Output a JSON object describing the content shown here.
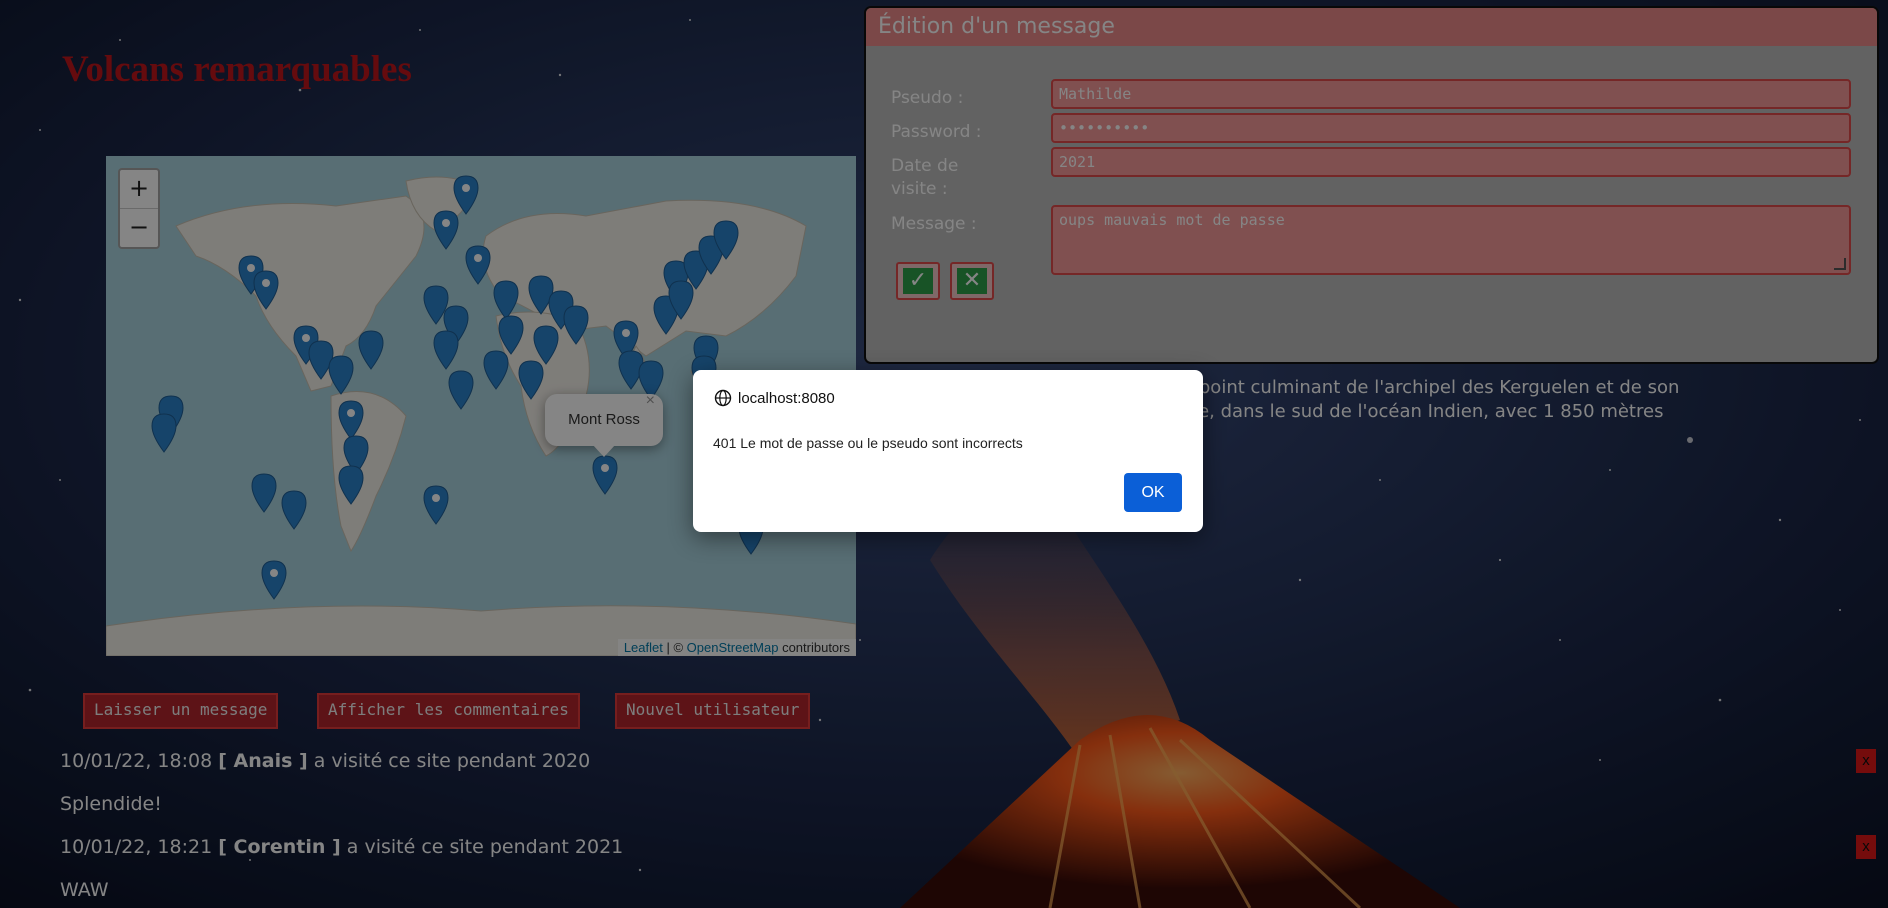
{
  "page": {
    "title": "Volcans remarquables",
    "description_lines": [
      "an, point culminant de l'archipel des Kerguelen et de son",
      "Terre, dans le sud de l'océan Indien, avec 1 850 mètres"
    ]
  },
  "map": {
    "zoom_in": "+",
    "zoom_out": "−",
    "popup_label": "Mont Ross",
    "popup_close": "×",
    "attribution": {
      "leaflet": "Leaflet",
      "separator": " | © ",
      "osm": "OpenStreetMap",
      "suffix": " contributors"
    }
  },
  "actions": {
    "leave_message": "Laisser un message",
    "show_comments": "Afficher les commentaires",
    "new_user": "Nouvel utilisateur"
  },
  "comments": [
    {
      "datetime": "10/01/22, 18:08",
      "user": "[ Anais ]",
      "visit": "a visité ce site pendant 2020",
      "text": "Splendide!",
      "delete": "x"
    },
    {
      "datetime": "10/01/22, 18:21",
      "user": "[ Corentin ]",
      "visit": "a visité ce site pendant 2021",
      "text": "WAW",
      "delete": "x"
    }
  ],
  "edit_panel": {
    "title": "Édition d'un message",
    "pseudo_label": "Pseudo :",
    "pseudo_value": "Mathilde",
    "password_label": "Password :",
    "password_value": "••••••••••",
    "date_label": "Date de visite :",
    "date_value": "2021",
    "message_label": "Message :",
    "message_value": "oups mauvais mot de passe",
    "confirm_icon": "✓",
    "cancel_icon": "✕"
  },
  "dialog": {
    "origin": "localhost:8080",
    "message": "401 Le mot de passe ou le pseudo sont incorrects",
    "ok_label": "OK"
  },
  "colors": {
    "title": "#c2161c",
    "button_bg": "#b3262c",
    "panel_header": "#ec8a8a",
    "dialog_ok": "#0b5fd7"
  }
}
